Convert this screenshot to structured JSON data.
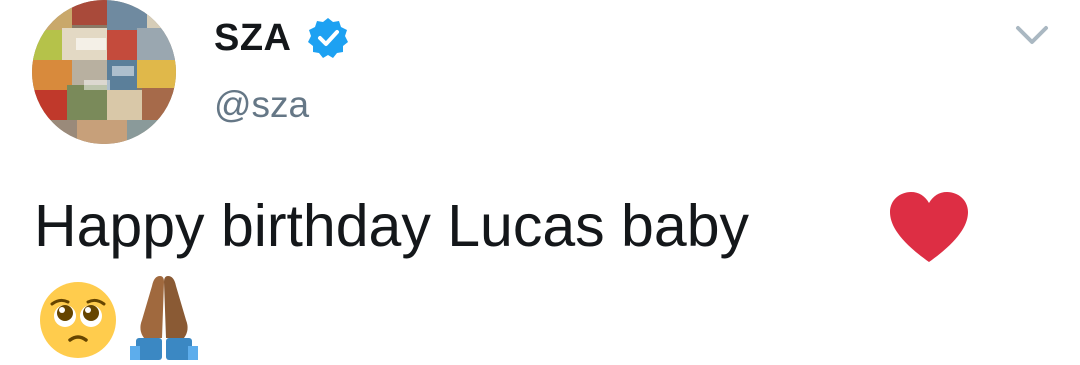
{
  "user": {
    "display_name": "SZA",
    "handle": "@sza",
    "verified": true,
    "avatar_icon": "luggage-tags-collage-avatar"
  },
  "tweet": {
    "text": "Happy birthday Lucas baby",
    "emojis": [
      "red-heart-icon",
      "pleading-face-icon",
      "folded-hands-icon"
    ]
  },
  "menu": {
    "icon": "chevron-down-icon"
  },
  "colors": {
    "text": "#14171a",
    "muted": "#657786",
    "verified_blue": "#1da1f2",
    "heart_red": "#dd2e44",
    "caret": "#aab8c2"
  }
}
